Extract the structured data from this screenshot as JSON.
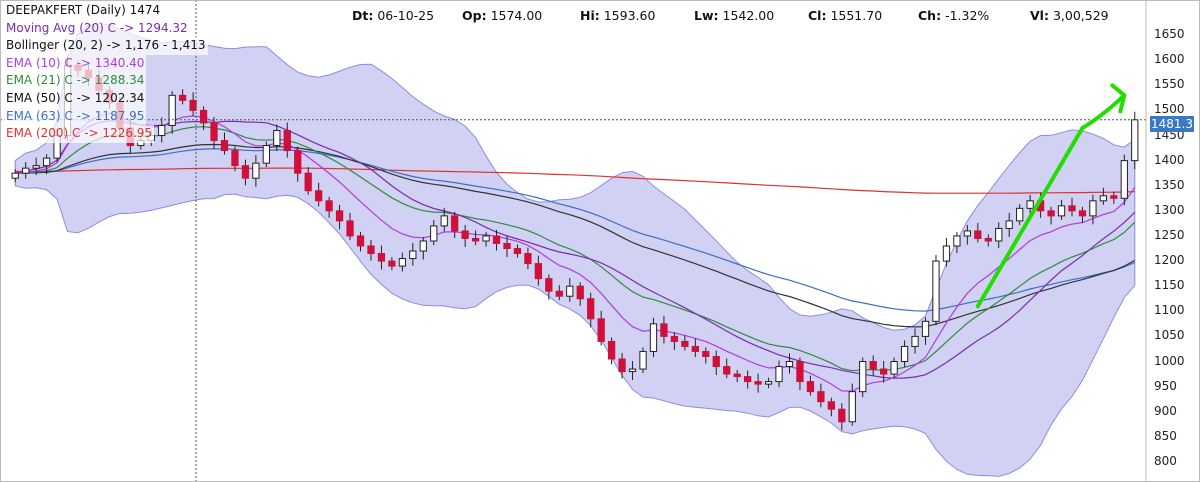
{
  "header": {
    "dt_label": "Dt:",
    "dt_value": "06-10-25",
    "op_label": "Op:",
    "op_value": "1574.00",
    "hi_label": "Hi:",
    "hi_value": "1593.60",
    "lw_label": "Lw:",
    "lw_value": "1542.00",
    "cl_label": "Cl:",
    "cl_value": "1551.70",
    "ch_label": "Ch:",
    "ch_value": "-1.32%",
    "vl_label": "Vl:",
    "vl_value": "3,00,529"
  },
  "legend": [
    {
      "text": "DEEPAKFERT (Daily) 1474",
      "color": "#111111"
    },
    {
      "text": "Moving Avg (20) C -> 1294.32",
      "color": "#7a2bb0"
    },
    {
      "text": "Bollinger (20, 2) -> 1,176 - 1,413",
      "color": "#111111"
    },
    {
      "text": "EMA (10) C -> 1340.40",
      "color": "#b03be0"
    },
    {
      "text": "EMA (21) C -> 1288.34",
      "color": "#2e8b3e"
    },
    {
      "text": "EMA (50) C -> 1202.34",
      "color": "#111111"
    },
    {
      "text": "EMA (63) C -> 1187.95",
      "color": "#3a70c8"
    },
    {
      "text": "EMA (200) C -> 1226.95",
      "color": "#e03030"
    }
  ],
  "last_price_label": "1481.3",
  "colors": {
    "up_candle": "#ffffff",
    "down_candle": "#d0103a",
    "candle_edge": "#222222",
    "bollinger_fill": "#c9c9f2",
    "bollinger_edge": "#8c8ce0",
    "ema200": "#e03030",
    "ema63": "#3a70c8",
    "ema50": "#333333",
    "ema21": "#2e8b3e",
    "ema10": "#b03be0",
    "sma20": "#7a2bb0",
    "arrow": "#22dd00",
    "price_tag": "#3a78c4"
  },
  "chart_data": {
    "type": "candlestick",
    "title": "DEEPAKFERT (Daily) 1474",
    "ylim": [
      780,
      1680
    ],
    "y_ticks": [
      800,
      850,
      900,
      950,
      1000,
      1050,
      1100,
      1150,
      1200,
      1250,
      1300,
      1350,
      1400,
      1450,
      1500,
      1550,
      1600,
      1650
    ],
    "grid": false,
    "legend_position": "top-left",
    "last_price": 1481.3,
    "close_trend": [
      1375,
      1385,
      1390,
      1405,
      1450,
      1590,
      1580,
      1565,
      1540,
      1515,
      1465,
      1430,
      1440,
      1450,
      1470,
      1530,
      1520,
      1500,
      1475,
      1440,
      1420,
      1390,
      1365,
      1395,
      1430,
      1460,
      1420,
      1375,
      1340,
      1320,
      1300,
      1280,
      1250,
      1230,
      1215,
      1200,
      1190,
      1205,
      1220,
      1240,
      1270,
      1290,
      1260,
      1245,
      1240,
      1250,
      1235,
      1225,
      1215,
      1195,
      1165,
      1140,
      1130,
      1150,
      1125,
      1085,
      1040,
      1005,
      980,
      985,
      1020,
      1075,
      1050,
      1040,
      1030,
      1020,
      1010,
      990,
      975,
      970,
      960,
      955,
      960,
      990,
      1000,
      960,
      940,
      920,
      905,
      880,
      940,
      1000,
      985,
      975,
      1000,
      1030,
      1050,
      1080,
      1200,
      1230,
      1250,
      1260,
      1245,
      1240,
      1265,
      1280,
      1305,
      1320,
      1300,
      1290,
      1310,
      1300,
      1290,
      1320,
      1330,
      1325,
      1400,
      1481.3
    ],
    "annotations": [
      {
        "type": "arrow",
        "color": "green",
        "from_value": 1110,
        "to_value": 1530
      }
    ]
  }
}
